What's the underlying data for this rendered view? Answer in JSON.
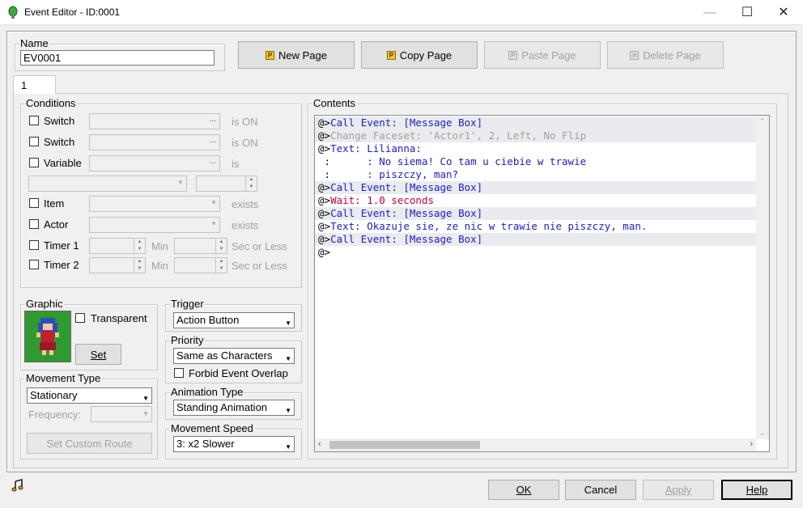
{
  "window": {
    "title": "Event Editor - ID:0001",
    "minimize": "—",
    "maximize": "☐",
    "close": "✕"
  },
  "name": {
    "label": "Name",
    "value": "EV0001"
  },
  "toolbar": {
    "new_page": "New Page",
    "copy_page": "Copy Page",
    "paste_page": "Paste Page",
    "delete_page": "Delete Page"
  },
  "tab": {
    "label": "1"
  },
  "conditions": {
    "label": "Conditions",
    "switch1": "Switch",
    "switch2": "Switch",
    "variable": "Variable",
    "item": "Item",
    "actor": "Actor",
    "timer1": "Timer 1",
    "timer2": "Timer 2",
    "is_on1": "is ON",
    "is_on2": "is ON",
    "is": "is",
    "exists1": "exists",
    "exists2": "exists",
    "min1": "Min",
    "min2": "Min",
    "sec1": "Sec or Less",
    "sec2": "Sec or Less",
    "ellipsis": "..."
  },
  "graphic": {
    "label": "Graphic",
    "transparent": "Transparent",
    "set": "Set"
  },
  "movement": {
    "label": "Movement Type",
    "type": "Stationary",
    "frequency": "Frequency:",
    "custom_route": "Set Custom Route"
  },
  "trigger": {
    "label": "Trigger",
    "value": "Action Button"
  },
  "priority": {
    "label": "Priority",
    "value": "Same as Characters",
    "forbid": "Forbid Event Overlap"
  },
  "animation": {
    "label": "Animation Type",
    "value": "Standing Animation"
  },
  "speed": {
    "label": "Movement Speed",
    "value": "3: x2 Slower"
  },
  "contents": {
    "label": "Contents",
    "lines": [
      {
        "prefix": "@>",
        "text": "Call Event: [Message Box]",
        "color": "blue",
        "hl": true
      },
      {
        "prefix": "@>",
        "text": "Change Faceset: 'Actor1', 2, Left, No Flip",
        "color": "grey",
        "hl": true
      },
      {
        "prefix": "@>",
        "text": "Text: Lilianna:",
        "color": "blue",
        "hl": false
      },
      {
        "prefix": " :",
        "text": "      : No siema! Co tam u ciebie w trawie",
        "color": "blue",
        "hl": false
      },
      {
        "prefix": " :",
        "text": "      : piszczy, man?",
        "color": "blue",
        "hl": false
      },
      {
        "prefix": "@>",
        "text": "Call Event: [Message Box]",
        "color": "blue",
        "hl": true
      },
      {
        "prefix": "@>",
        "text": "Wait: 1.0 seconds",
        "color": "red",
        "hl": false
      },
      {
        "prefix": "@>",
        "text": "Call Event: [Message Box]",
        "color": "blue",
        "hl": true
      },
      {
        "prefix": "@>",
        "text": "Text: Okazuje sie, ze nic w trawie nie piszczy, man.",
        "color": "blue",
        "hl": false
      },
      {
        "prefix": "@>",
        "text": "Call Event: [Message Box]",
        "color": "blue",
        "hl": true
      },
      {
        "prefix": "@>",
        "text": "",
        "color": "blue",
        "hl": false
      }
    ]
  },
  "footer": {
    "ok": "OK",
    "cancel": "Cancel",
    "apply": "Apply",
    "help": "Help"
  }
}
